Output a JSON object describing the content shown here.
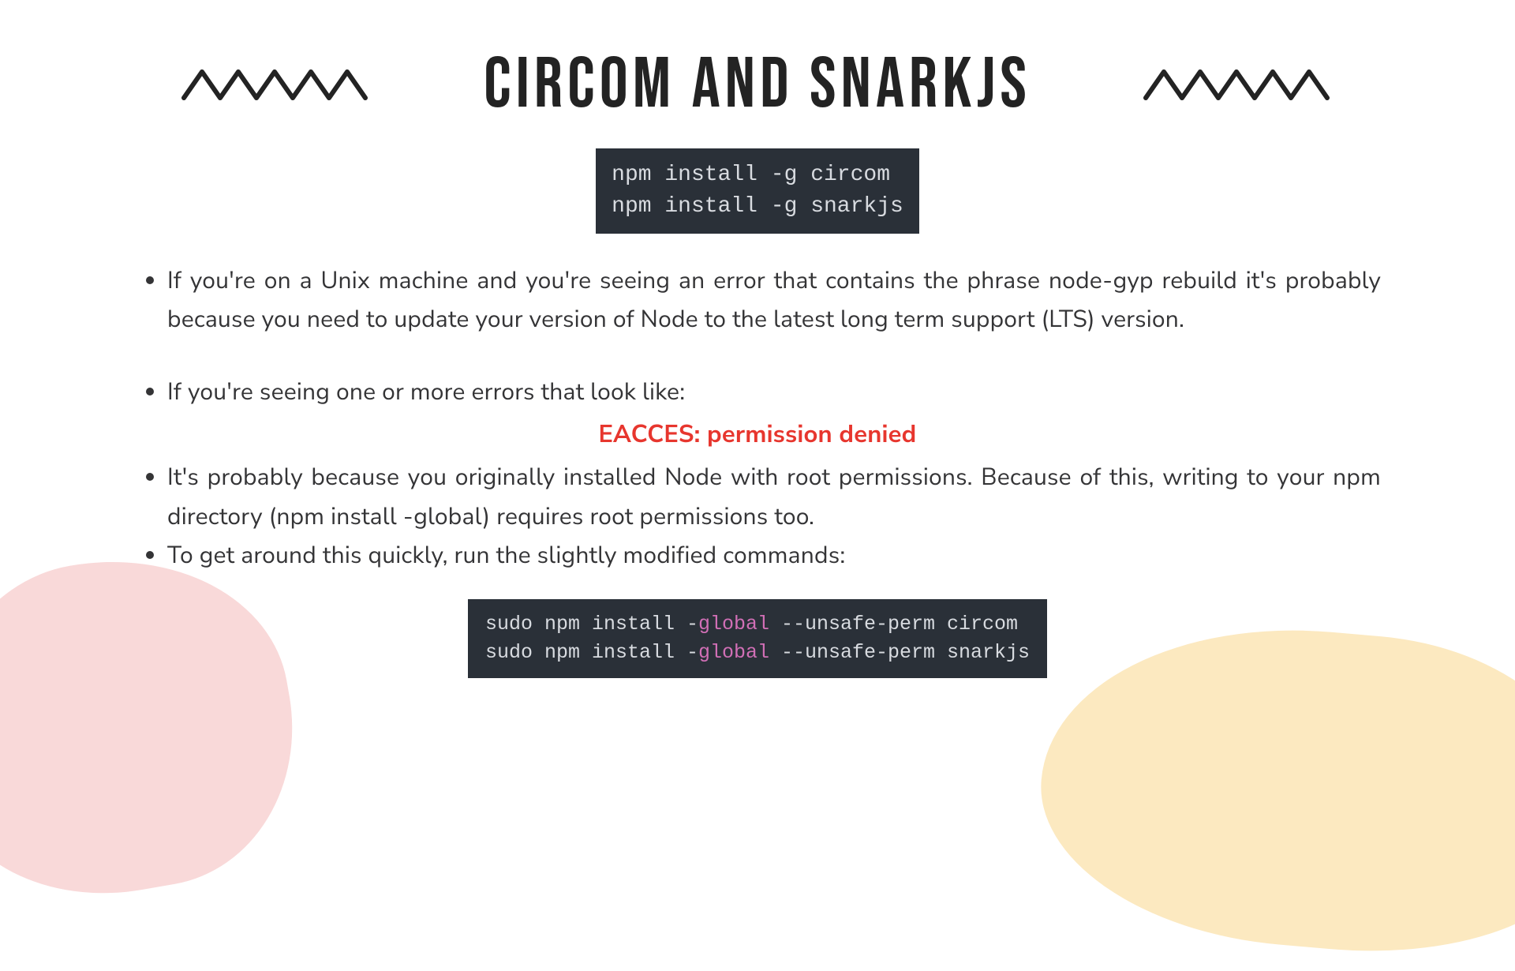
{
  "title": "CIRCOM AND SNARKJS",
  "code1": {
    "line1": "npm install -g circom",
    "line2": "npm install -g snarkjs"
  },
  "bullets": {
    "b1": "If you're on a Unix machine and you're seeing an error that contains the phrase node-gyp rebuild it's probably because you need to update your version of Node to the latest long term support (LTS) version.",
    "b2": "If you're seeing one or more errors that look like:",
    "error": "EACCES: permission denied",
    "b3": "It's probably because you originally installed Node with root permissions. Because of this, writing to your npm directory (npm install -global) requires root permissions too.",
    "b4": "To get around this quickly, run the slightly modified commands:"
  },
  "code2": {
    "l1a": "sudo npm install -",
    "l1b": "global",
    "l1c": " --unsafe-perm circom",
    "l2a": "sudo npm install -",
    "l2b": "global",
    "l2c": " --unsafe-perm snarkjs"
  }
}
